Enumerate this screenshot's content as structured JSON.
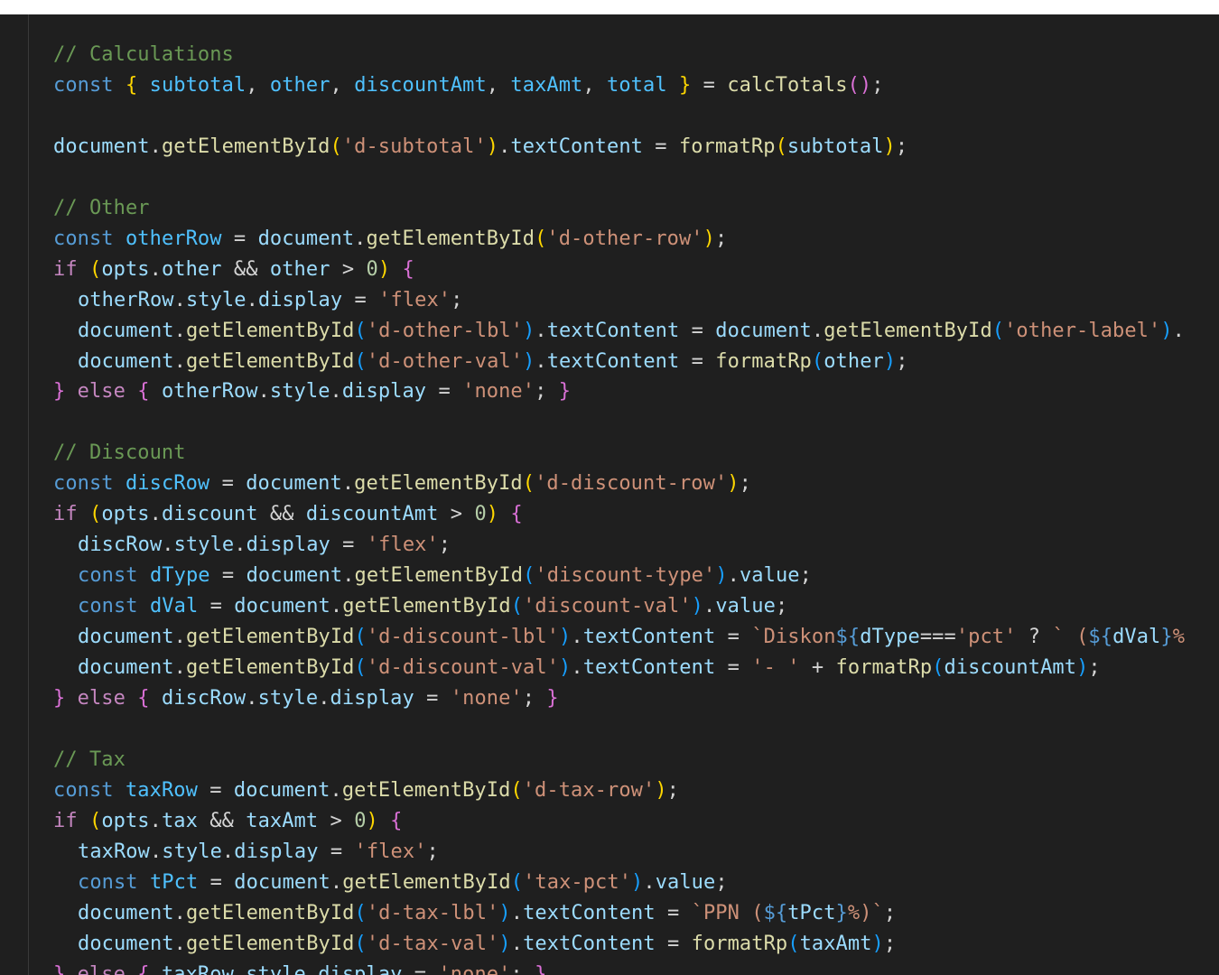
{
  "theme": {
    "background": "#1f1f1f",
    "comment": "#6a9955",
    "keyword": "#569cd6",
    "control": "#c586c0",
    "variable": "#9cdcfe",
    "function": "#dcdcaa",
    "string": "#ce9178",
    "number": "#b5cea8",
    "bracket_level_1": "#ffd700",
    "bracket_level_2": "#da70d6",
    "bracket_level_3": "#179fff"
  },
  "lines": [
    {
      "indent": 1,
      "tokens": [
        [
          "comment",
          "// Calculations"
        ]
      ]
    },
    {
      "indent": 1,
      "tokens": [
        [
          "keyword",
          "const"
        ],
        [
          "plain",
          " "
        ],
        [
          "b1",
          "{"
        ],
        [
          "plain",
          " "
        ],
        [
          "const",
          "subtotal"
        ],
        [
          "plain",
          ", "
        ],
        [
          "const",
          "other"
        ],
        [
          "plain",
          ", "
        ],
        [
          "const",
          "discountAmt"
        ],
        [
          "plain",
          ", "
        ],
        [
          "const",
          "taxAmt"
        ],
        [
          "plain",
          ", "
        ],
        [
          "const",
          "total"
        ],
        [
          "plain",
          " "
        ],
        [
          "b1",
          "}"
        ],
        [
          "plain",
          " = "
        ],
        [
          "fn",
          "calcTotals"
        ],
        [
          "b2",
          "()"
        ],
        [
          "plain",
          ";"
        ]
      ]
    },
    {
      "indent": 1,
      "tokens": []
    },
    {
      "indent": 1,
      "tokens": [
        [
          "var",
          "document"
        ],
        [
          "plain",
          "."
        ],
        [
          "fn",
          "getElementById"
        ],
        [
          "b1",
          "("
        ],
        [
          "str",
          "'d-subtotal'"
        ],
        [
          "b1",
          ")"
        ],
        [
          "plain",
          "."
        ],
        [
          "var",
          "textContent"
        ],
        [
          "plain",
          " = "
        ],
        [
          "fn",
          "formatRp"
        ],
        [
          "b1",
          "("
        ],
        [
          "var",
          "subtotal"
        ],
        [
          "b1",
          ")"
        ],
        [
          "plain",
          ";"
        ]
      ]
    },
    {
      "indent": 1,
      "tokens": []
    },
    {
      "indent": 1,
      "tokens": [
        [
          "comment",
          "// Other"
        ]
      ]
    },
    {
      "indent": 1,
      "tokens": [
        [
          "keyword",
          "const"
        ],
        [
          "plain",
          " "
        ],
        [
          "const",
          "otherRow"
        ],
        [
          "plain",
          " = "
        ],
        [
          "var",
          "document"
        ],
        [
          "plain",
          "."
        ],
        [
          "fn",
          "getElementById"
        ],
        [
          "b1",
          "("
        ],
        [
          "str",
          "'d-other-row'"
        ],
        [
          "b1",
          ")"
        ],
        [
          "plain",
          ";"
        ]
      ]
    },
    {
      "indent": 1,
      "tokens": [
        [
          "control",
          "if"
        ],
        [
          "plain",
          " "
        ],
        [
          "b1",
          "("
        ],
        [
          "var",
          "opts"
        ],
        [
          "plain",
          "."
        ],
        [
          "var",
          "other"
        ],
        [
          "plain",
          " && "
        ],
        [
          "var",
          "other"
        ],
        [
          "plain",
          " > "
        ],
        [
          "num",
          "0"
        ],
        [
          "b1",
          ")"
        ],
        [
          "plain",
          " "
        ],
        [
          "b2",
          "{"
        ]
      ]
    },
    {
      "indent": 2,
      "tokens": [
        [
          "var",
          "otherRow"
        ],
        [
          "plain",
          "."
        ],
        [
          "var",
          "style"
        ],
        [
          "plain",
          "."
        ],
        [
          "var",
          "display"
        ],
        [
          "plain",
          " = "
        ],
        [
          "str",
          "'flex'"
        ],
        [
          "plain",
          ";"
        ]
      ]
    },
    {
      "indent": 2,
      "tokens": [
        [
          "var",
          "document"
        ],
        [
          "plain",
          "."
        ],
        [
          "fn",
          "getElementById"
        ],
        [
          "b3",
          "("
        ],
        [
          "str",
          "'d-other-lbl'"
        ],
        [
          "b3",
          ")"
        ],
        [
          "plain",
          "."
        ],
        [
          "var",
          "textContent"
        ],
        [
          "plain",
          " = "
        ],
        [
          "var",
          "document"
        ],
        [
          "plain",
          "."
        ],
        [
          "fn",
          "getElementById"
        ],
        [
          "b3",
          "("
        ],
        [
          "str",
          "'other-label'"
        ],
        [
          "b3",
          ")"
        ],
        [
          "plain",
          "."
        ]
      ]
    },
    {
      "indent": 2,
      "tokens": [
        [
          "var",
          "document"
        ],
        [
          "plain",
          "."
        ],
        [
          "fn",
          "getElementById"
        ],
        [
          "b3",
          "("
        ],
        [
          "str",
          "'d-other-val'"
        ],
        [
          "b3",
          ")"
        ],
        [
          "plain",
          "."
        ],
        [
          "var",
          "textContent"
        ],
        [
          "plain",
          " = "
        ],
        [
          "fn",
          "formatRp"
        ],
        [
          "b3",
          "("
        ],
        [
          "var",
          "other"
        ],
        [
          "b3",
          ")"
        ],
        [
          "plain",
          ";"
        ]
      ]
    },
    {
      "indent": 1,
      "tokens": [
        [
          "b2",
          "}"
        ],
        [
          "plain",
          " "
        ],
        [
          "control",
          "else"
        ],
        [
          "plain",
          " "
        ],
        [
          "b2",
          "{"
        ],
        [
          "plain",
          " "
        ],
        [
          "var",
          "otherRow"
        ],
        [
          "plain",
          "."
        ],
        [
          "var",
          "style"
        ],
        [
          "plain",
          "."
        ],
        [
          "var",
          "display"
        ],
        [
          "plain",
          " = "
        ],
        [
          "str",
          "'none'"
        ],
        [
          "plain",
          "; "
        ],
        [
          "b2",
          "}"
        ]
      ]
    },
    {
      "indent": 1,
      "tokens": []
    },
    {
      "indent": 1,
      "tokens": [
        [
          "comment",
          "// Discount"
        ]
      ]
    },
    {
      "indent": 1,
      "tokens": [
        [
          "keyword",
          "const"
        ],
        [
          "plain",
          " "
        ],
        [
          "const",
          "discRow"
        ],
        [
          "plain",
          " = "
        ],
        [
          "var",
          "document"
        ],
        [
          "plain",
          "."
        ],
        [
          "fn",
          "getElementById"
        ],
        [
          "b1",
          "("
        ],
        [
          "str",
          "'d-discount-row'"
        ],
        [
          "b1",
          ")"
        ],
        [
          "plain",
          ";"
        ]
      ]
    },
    {
      "indent": 1,
      "tokens": [
        [
          "control",
          "if"
        ],
        [
          "plain",
          " "
        ],
        [
          "b1",
          "("
        ],
        [
          "var",
          "opts"
        ],
        [
          "plain",
          "."
        ],
        [
          "var",
          "discount"
        ],
        [
          "plain",
          " && "
        ],
        [
          "var",
          "discountAmt"
        ],
        [
          "plain",
          " > "
        ],
        [
          "num",
          "0"
        ],
        [
          "b1",
          ")"
        ],
        [
          "plain",
          " "
        ],
        [
          "b2",
          "{"
        ]
      ]
    },
    {
      "indent": 2,
      "tokens": [
        [
          "var",
          "discRow"
        ],
        [
          "plain",
          "."
        ],
        [
          "var",
          "style"
        ],
        [
          "plain",
          "."
        ],
        [
          "var",
          "display"
        ],
        [
          "plain",
          " = "
        ],
        [
          "str",
          "'flex'"
        ],
        [
          "plain",
          ";"
        ]
      ]
    },
    {
      "indent": 2,
      "tokens": [
        [
          "keyword",
          "const"
        ],
        [
          "plain",
          " "
        ],
        [
          "const",
          "dType"
        ],
        [
          "plain",
          " = "
        ],
        [
          "var",
          "document"
        ],
        [
          "plain",
          "."
        ],
        [
          "fn",
          "getElementById"
        ],
        [
          "b3",
          "("
        ],
        [
          "str",
          "'discount-type'"
        ],
        [
          "b3",
          ")"
        ],
        [
          "plain",
          "."
        ],
        [
          "var",
          "value"
        ],
        [
          "plain",
          ";"
        ]
      ]
    },
    {
      "indent": 2,
      "tokens": [
        [
          "keyword",
          "const"
        ],
        [
          "plain",
          " "
        ],
        [
          "const",
          "dVal"
        ],
        [
          "plain",
          " = "
        ],
        [
          "var",
          "document"
        ],
        [
          "plain",
          "."
        ],
        [
          "fn",
          "getElementById"
        ],
        [
          "b3",
          "("
        ],
        [
          "str",
          "'discount-val'"
        ],
        [
          "b3",
          ")"
        ],
        [
          "plain",
          "."
        ],
        [
          "var",
          "value"
        ],
        [
          "plain",
          ";"
        ]
      ]
    },
    {
      "indent": 2,
      "tokens": [
        [
          "var",
          "document"
        ],
        [
          "plain",
          "."
        ],
        [
          "fn",
          "getElementById"
        ],
        [
          "b3",
          "("
        ],
        [
          "str",
          "'d-discount-lbl'"
        ],
        [
          "b3",
          ")"
        ],
        [
          "plain",
          "."
        ],
        [
          "var",
          "textContent"
        ],
        [
          "plain",
          " = "
        ],
        [
          "str",
          "`Diskon"
        ],
        [
          "keyword",
          "${"
        ],
        [
          "var",
          "dType"
        ],
        [
          "plain",
          "==="
        ],
        [
          "str",
          "'pct'"
        ],
        [
          "plain",
          " ? "
        ],
        [
          "str",
          "` ("
        ],
        [
          "keyword",
          "${"
        ],
        [
          "var",
          "dVal"
        ],
        [
          "keyword",
          "}"
        ],
        [
          "str",
          "%"
        ]
      ]
    },
    {
      "indent": 2,
      "tokens": [
        [
          "var",
          "document"
        ],
        [
          "plain",
          "."
        ],
        [
          "fn",
          "getElementById"
        ],
        [
          "b3",
          "("
        ],
        [
          "str",
          "'d-discount-val'"
        ],
        [
          "b3",
          ")"
        ],
        [
          "plain",
          "."
        ],
        [
          "var",
          "textContent"
        ],
        [
          "plain",
          " = "
        ],
        [
          "str",
          "'- '"
        ],
        [
          "plain",
          " + "
        ],
        [
          "fn",
          "formatRp"
        ],
        [
          "b3",
          "("
        ],
        [
          "var",
          "discountAmt"
        ],
        [
          "b3",
          ")"
        ],
        [
          "plain",
          ";"
        ]
      ]
    },
    {
      "indent": 1,
      "tokens": [
        [
          "b2",
          "}"
        ],
        [
          "plain",
          " "
        ],
        [
          "control",
          "else"
        ],
        [
          "plain",
          " "
        ],
        [
          "b2",
          "{"
        ],
        [
          "plain",
          " "
        ],
        [
          "var",
          "discRow"
        ],
        [
          "plain",
          "."
        ],
        [
          "var",
          "style"
        ],
        [
          "plain",
          "."
        ],
        [
          "var",
          "display"
        ],
        [
          "plain",
          " = "
        ],
        [
          "str",
          "'none'"
        ],
        [
          "plain",
          "; "
        ],
        [
          "b2",
          "}"
        ]
      ]
    },
    {
      "indent": 1,
      "tokens": []
    },
    {
      "indent": 1,
      "tokens": [
        [
          "comment",
          "// Tax"
        ]
      ]
    },
    {
      "indent": 1,
      "tokens": [
        [
          "keyword",
          "const"
        ],
        [
          "plain",
          " "
        ],
        [
          "const",
          "taxRow"
        ],
        [
          "plain",
          " = "
        ],
        [
          "var",
          "document"
        ],
        [
          "plain",
          "."
        ],
        [
          "fn",
          "getElementById"
        ],
        [
          "b1",
          "("
        ],
        [
          "str",
          "'d-tax-row'"
        ],
        [
          "b1",
          ")"
        ],
        [
          "plain",
          ";"
        ]
      ]
    },
    {
      "indent": 1,
      "tokens": [
        [
          "control",
          "if"
        ],
        [
          "plain",
          " "
        ],
        [
          "b1",
          "("
        ],
        [
          "var",
          "opts"
        ],
        [
          "plain",
          "."
        ],
        [
          "var",
          "tax"
        ],
        [
          "plain",
          " && "
        ],
        [
          "var",
          "taxAmt"
        ],
        [
          "plain",
          " > "
        ],
        [
          "num",
          "0"
        ],
        [
          "b1",
          ")"
        ],
        [
          "plain",
          " "
        ],
        [
          "b2",
          "{"
        ]
      ]
    },
    {
      "indent": 2,
      "tokens": [
        [
          "var",
          "taxRow"
        ],
        [
          "plain",
          "."
        ],
        [
          "var",
          "style"
        ],
        [
          "plain",
          "."
        ],
        [
          "var",
          "display"
        ],
        [
          "plain",
          " = "
        ],
        [
          "str",
          "'flex'"
        ],
        [
          "plain",
          ";"
        ]
      ]
    },
    {
      "indent": 2,
      "tokens": [
        [
          "keyword",
          "const"
        ],
        [
          "plain",
          " "
        ],
        [
          "const",
          "tPct"
        ],
        [
          "plain",
          " = "
        ],
        [
          "var",
          "document"
        ],
        [
          "plain",
          "."
        ],
        [
          "fn",
          "getElementById"
        ],
        [
          "b3",
          "("
        ],
        [
          "str",
          "'tax-pct'"
        ],
        [
          "b3",
          ")"
        ],
        [
          "plain",
          "."
        ],
        [
          "var",
          "value"
        ],
        [
          "plain",
          ";"
        ]
      ]
    },
    {
      "indent": 2,
      "tokens": [
        [
          "var",
          "document"
        ],
        [
          "plain",
          "."
        ],
        [
          "fn",
          "getElementById"
        ],
        [
          "b3",
          "("
        ],
        [
          "str",
          "'d-tax-lbl'"
        ],
        [
          "b3",
          ")"
        ],
        [
          "plain",
          "."
        ],
        [
          "var",
          "textContent"
        ],
        [
          "plain",
          " = "
        ],
        [
          "str",
          "`PPN ("
        ],
        [
          "keyword",
          "${"
        ],
        [
          "var",
          "tPct"
        ],
        [
          "keyword",
          "}"
        ],
        [
          "str",
          "%)`"
        ],
        [
          "plain",
          ";"
        ]
      ]
    },
    {
      "indent": 2,
      "tokens": [
        [
          "var",
          "document"
        ],
        [
          "plain",
          "."
        ],
        [
          "fn",
          "getElementById"
        ],
        [
          "b3",
          "("
        ],
        [
          "str",
          "'d-tax-val'"
        ],
        [
          "b3",
          ")"
        ],
        [
          "plain",
          "."
        ],
        [
          "var",
          "textContent"
        ],
        [
          "plain",
          " = "
        ],
        [
          "fn",
          "formatRp"
        ],
        [
          "b3",
          "("
        ],
        [
          "var",
          "taxAmt"
        ],
        [
          "b3",
          ")"
        ],
        [
          "plain",
          ";"
        ]
      ]
    },
    {
      "indent": 1,
      "tokens": [
        [
          "b2",
          "}"
        ],
        [
          "plain",
          " "
        ],
        [
          "control",
          "else"
        ],
        [
          "plain",
          " "
        ],
        [
          "b2",
          "{"
        ],
        [
          "plain",
          " "
        ],
        [
          "var",
          "taxRow"
        ],
        [
          "plain",
          "."
        ],
        [
          "var",
          "style"
        ],
        [
          "plain",
          "."
        ],
        [
          "var",
          "display"
        ],
        [
          "plain",
          " = "
        ],
        [
          "str",
          "'none'"
        ],
        [
          "plain",
          "; "
        ],
        [
          "b2",
          "}"
        ]
      ]
    }
  ]
}
